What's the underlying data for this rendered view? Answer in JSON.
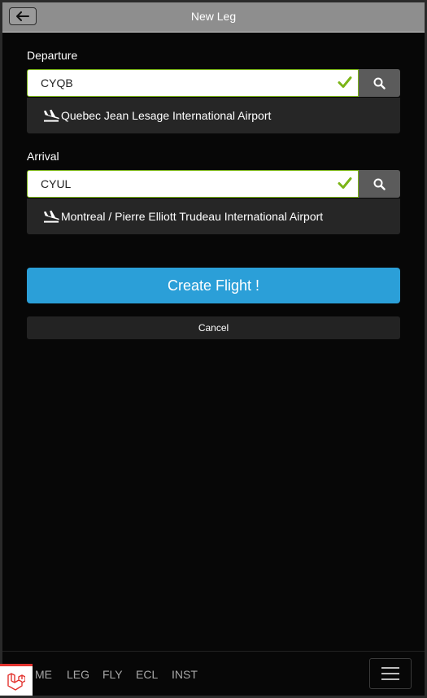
{
  "header": {
    "title": "New Leg"
  },
  "departure": {
    "label": "Departure",
    "code": "CYQB",
    "airport_name": "Quebec Jean Lesage International Airport"
  },
  "arrival": {
    "label": "Arrival",
    "code": "CYUL",
    "airport_name": "Montreal / Pierre Elliott Trudeau International Airport"
  },
  "actions": {
    "create_label": "Create Flight !",
    "cancel_label": "Cancel"
  },
  "bottom_nav": {
    "items": [
      "ME",
      "LEG",
      "FLY",
      "ECL",
      "INST"
    ]
  },
  "colors": {
    "accent": "#2b9fd8",
    "valid": "#7cb518",
    "header": "#8e8e8e"
  },
  "icons": [
    "back-arrow-icon",
    "check-icon",
    "search-icon",
    "airplane-landing-icon",
    "hamburger-menu-icon",
    "laravel-logo-icon"
  ]
}
